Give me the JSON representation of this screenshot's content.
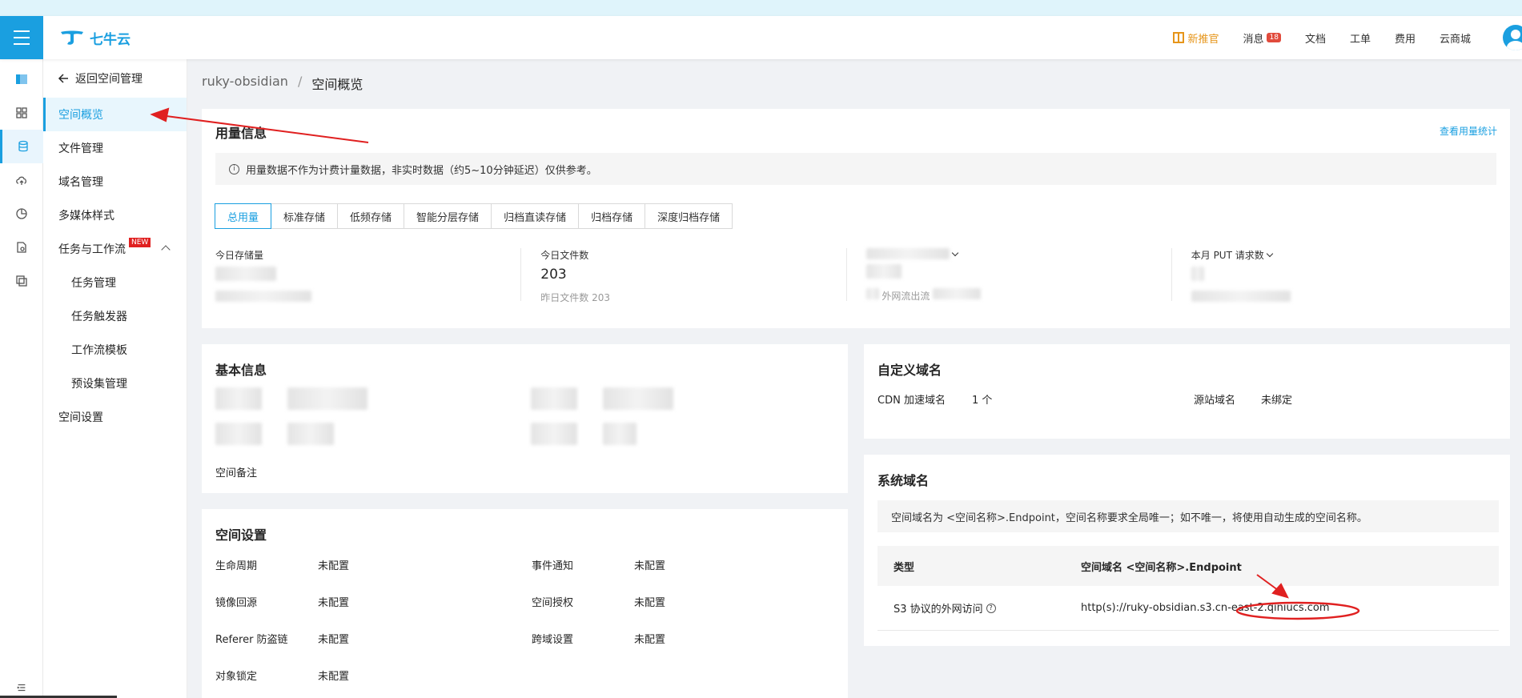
{
  "header": {
    "logo_text": "七牛云",
    "promo": "新推官",
    "messages": "消息",
    "messages_count": "18",
    "docs": "文档",
    "tickets": "工单",
    "billing": "费用",
    "marketplace": "云商城"
  },
  "sidebar": {
    "back": "返回空间管理",
    "items": [
      {
        "label": "空间概览"
      },
      {
        "label": "文件管理"
      },
      {
        "label": "域名管理"
      },
      {
        "label": "多媒体样式"
      },
      {
        "label": "任务与工作流"
      },
      {
        "label": "任务管理"
      },
      {
        "label": "任务触发器"
      },
      {
        "label": "工作流模板"
      },
      {
        "label": "预设集管理"
      },
      {
        "label": "空间设置"
      }
    ],
    "new_badge": "NEW"
  },
  "breadcrumb": {
    "parent": "ruky-obsidian",
    "separator": "/",
    "current": "空间概览"
  },
  "usage": {
    "title": "用量信息",
    "link": "查看用量统计",
    "notice": "用量数据不作为计费计量数据，非实时数据（约5~10分钟延迟）仅供参考。",
    "tabs": [
      "总用量",
      "标准存储",
      "低频存储",
      "智能分层存储",
      "归档直读存储",
      "归档存储",
      "深度归档存储"
    ],
    "stats": [
      {
        "label": "今日存储量",
        "value": "",
        "sub": ""
      },
      {
        "label": "今日文件数",
        "value": "203",
        "sub": "昨日文件数 203"
      },
      {
        "label": "本月外网流出流量",
        "value": "",
        "sub": "外网流出流"
      },
      {
        "label": "本月 PUT 请求数",
        "value": "",
        "sub": ""
      }
    ]
  },
  "basic_info": {
    "title": "基本信息",
    "remark": "空间备注"
  },
  "space_settings": {
    "title": "空间设置",
    "items": [
      {
        "key": "生命周期",
        "value": "未配置"
      },
      {
        "key": "事件通知",
        "value": "未配置"
      },
      {
        "key": "镜像回源",
        "value": "未配置"
      },
      {
        "key": "空间授权",
        "value": "未配置"
      },
      {
        "key": "Referer 防盗链",
        "value": "未配置"
      },
      {
        "key": "跨域设置",
        "value": "未配置"
      },
      {
        "key": "对象锁定",
        "value": "未配置"
      }
    ]
  },
  "custom_domain": {
    "title": "自定义域名",
    "cdn_label": "CDN 加速域名",
    "cdn_value": "1 个",
    "origin_label": "源站域名",
    "origin_value": "未绑定"
  },
  "system_domain": {
    "title": "系统域名",
    "notice": "空间域名为 <空间名称>.Endpoint，空间名称要求全局唯一；如不唯一，将使用自动生成的空间名称。",
    "col_type": "类型",
    "col_domain": "空间域名 <空间名称>.Endpoint",
    "row_type": "S3 协议的外网访问",
    "row_domain": "http(s)://ruky-obsidian.s3.cn-east-2.qiniucs.com"
  },
  "colors": {
    "accent": "#1a9fe0",
    "annotation": "#e02020"
  }
}
